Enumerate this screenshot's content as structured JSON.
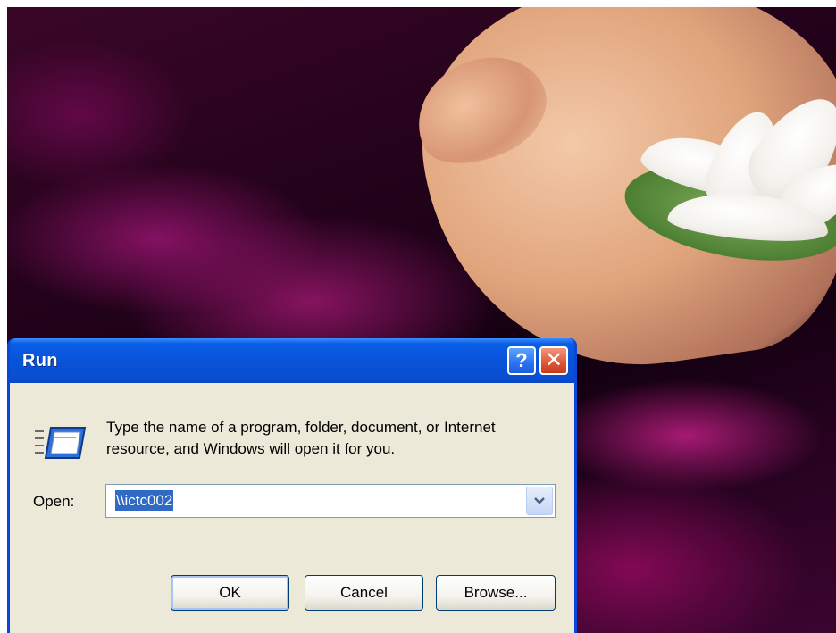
{
  "dialog": {
    "title": "Run",
    "help_button_glyph": "?",
    "close_button_glyph": "✕",
    "icon": "run-program-icon",
    "description": "Type the name of a program, folder, document, or Internet resource, and Windows will open it for you.",
    "open_label": "Open:",
    "open_value": "\\\\ictc002",
    "buttons": {
      "ok": "OK",
      "cancel": "Cancel",
      "browse": "Browse..."
    }
  },
  "colors": {
    "titlebar": "#0853d8",
    "dialog_body": "#ece9d8",
    "close_button": "#e05a3a",
    "selection": "#316ac5"
  }
}
